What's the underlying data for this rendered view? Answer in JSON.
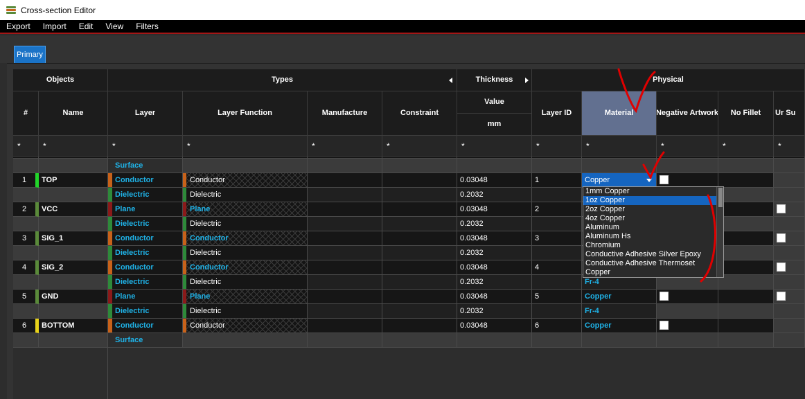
{
  "window": {
    "title": "Cross-section Editor"
  },
  "menu": [
    "Export",
    "Import",
    "Edit",
    "View",
    "Filters"
  ],
  "tabs": [
    {
      "label": "Primary",
      "active": true
    }
  ],
  "groups": {
    "objects": "Objects",
    "types": "Types",
    "thickness": "Thickness",
    "physical": "Physical"
  },
  "columns": {
    "num": "#",
    "name": "Name",
    "layer": "Layer",
    "layer_function": "Layer Function",
    "manufacture": "Manufacture",
    "constraint": "Constraint",
    "value": "Value",
    "unit": "mm",
    "layer_id": "Layer ID",
    "material": "Material",
    "negative_artwork": "Negative Artwork",
    "no_fillet": "No Fillet",
    "partial_next": "Ur Su"
  },
  "filter_text": "*",
  "rows": [
    {
      "num": "",
      "name": "",
      "layer": "Surface",
      "function": "",
      "thickness": "",
      "layer_id": "",
      "material": "",
      "kind": "surface"
    },
    {
      "num": "1",
      "name": "TOP",
      "layer": "Conductor",
      "function": "Conductor",
      "thickness": "0.03048",
      "layer_id": "1",
      "material": "Copper",
      "kind": "conductor",
      "num_color": "#22d52a",
      "func_cyan": false,
      "neg_cb": true,
      "ur_cb": false
    },
    {
      "num": "",
      "name": "",
      "layer": "Dielectric",
      "function": "Dielectric",
      "thickness": "0.2032",
      "layer_id": "",
      "material": "",
      "kind": "dielectric"
    },
    {
      "num": "2",
      "name": "VCC",
      "layer": "Plane",
      "function": "Plane",
      "thickness": "0.03048",
      "layer_id": "2",
      "material": "",
      "kind": "plane",
      "num_color": "#5a8a3a",
      "func_cyan": true,
      "neg_cb": false,
      "ur_cb": true
    },
    {
      "num": "",
      "name": "",
      "layer": "Dielectric",
      "function": "Dielectric",
      "thickness": "0.2032",
      "layer_id": "",
      "material": "",
      "kind": "dielectric"
    },
    {
      "num": "3",
      "name": "SIG_1",
      "layer": "Conductor",
      "function": "Conductor",
      "thickness": "0.03048",
      "layer_id": "3",
      "material": "",
      "kind": "conductor",
      "num_color": "#5a8a3a",
      "func_cyan": true,
      "neg_cb": false,
      "ur_cb": true
    },
    {
      "num": "",
      "name": "",
      "layer": "Dielectric",
      "function": "Dielectric",
      "thickness": "0.2032",
      "layer_id": "",
      "material": "",
      "kind": "dielectric"
    },
    {
      "num": "4",
      "name": "SIG_2",
      "layer": "Conductor",
      "function": "Conductor",
      "thickness": "0.03048",
      "layer_id": "4",
      "material": "",
      "kind": "conductor",
      "num_color": "#5a8a3a",
      "func_cyan": true,
      "neg_cb": false,
      "ur_cb": true
    },
    {
      "num": "",
      "name": "",
      "layer": "Dielectric",
      "function": "Dielectric",
      "thickness": "0.2032",
      "layer_id": "",
      "material": "Fr-4",
      "kind": "dielectric"
    },
    {
      "num": "5",
      "name": "GND",
      "layer": "Plane",
      "function": "Plane",
      "thickness": "0.03048",
      "layer_id": "5",
      "material": "Copper",
      "kind": "plane",
      "num_color": "#5a8a3a",
      "func_cyan": true,
      "neg_cb": true,
      "ur_cb": true
    },
    {
      "num": "",
      "name": "",
      "layer": "Dielectric",
      "function": "Dielectric",
      "thickness": "0.2032",
      "layer_id": "",
      "material": "Fr-4",
      "kind": "dielectric"
    },
    {
      "num": "6",
      "name": "BOTTOM",
      "layer": "Conductor",
      "function": "Conductor",
      "thickness": "0.03048",
      "layer_id": "6",
      "material": "Copper",
      "kind": "conductor",
      "num_color": "#e8d21a",
      "func_cyan": false,
      "neg_cb": true,
      "ur_cb": false
    },
    {
      "num": "",
      "name": "",
      "layer": "Surface",
      "function": "",
      "thickness": "",
      "layer_id": "",
      "material": "",
      "kind": "surface"
    }
  ],
  "material_dropdown": {
    "selected": "Copper",
    "highlighted_index": 1,
    "options": [
      "1mm Copper",
      "1oz Copper",
      "2oz Copper",
      "4oz Copper",
      "Aluminum",
      "Aluminum Hs",
      "Chromium",
      "Conductive Adhesive Silver Epoxy",
      "Conductive Adhesive Thermoset",
      "Copper"
    ]
  },
  "colors": {
    "accent": "#1565c0",
    "header_selected": "#627090",
    "cyan_text": "#1fb3e8",
    "conductor": "#c8621a",
    "plane": "#8b1a1a",
    "dielectric": "#2e8a3a",
    "annotation": "#e00000"
  }
}
